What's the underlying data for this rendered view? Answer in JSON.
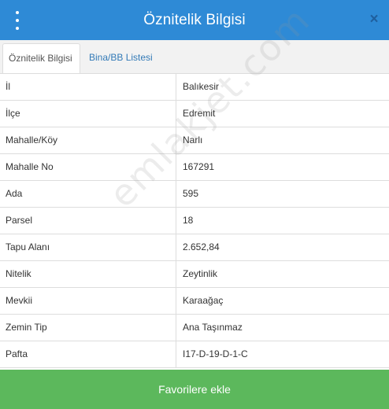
{
  "header": {
    "title": "Öznitelik Bilgisi",
    "menu_icon": "kebab-menu-icon",
    "close_icon": "close-icon",
    "close_glyph": "×"
  },
  "tabs": [
    {
      "label": "Öznitelik Bilgisi",
      "active": true
    },
    {
      "label": "Bina/BB Listesi",
      "active": false
    }
  ],
  "attributes": [
    {
      "key": "İl",
      "value": "Balıkesir"
    },
    {
      "key": "İlçe",
      "value": "Edremit"
    },
    {
      "key": "Mahalle/Köy",
      "value": "Narlı"
    },
    {
      "key": "Mahalle No",
      "value": "167291"
    },
    {
      "key": "Ada",
      "value": "595"
    },
    {
      "key": "Parsel",
      "value": "18"
    },
    {
      "key": "Tapu Alanı",
      "value": "2.652,84"
    },
    {
      "key": "Nitelik",
      "value": "Zeytinlik"
    },
    {
      "key": "Mevkii",
      "value": "Karaağaç"
    },
    {
      "key": "Zemin Tip",
      "value": "Ana Taşınmaz"
    },
    {
      "key": "Pafta",
      "value": "I17-D-19-D-1-C"
    }
  ],
  "watermark": "emlakjet.com",
  "footer": {
    "favorite_button_label": "Favorilere ekle"
  },
  "colors": {
    "header_bg": "#2e8ad6",
    "tab_link": "#337ab7",
    "favorite_button_bg": "#5cb85c"
  }
}
